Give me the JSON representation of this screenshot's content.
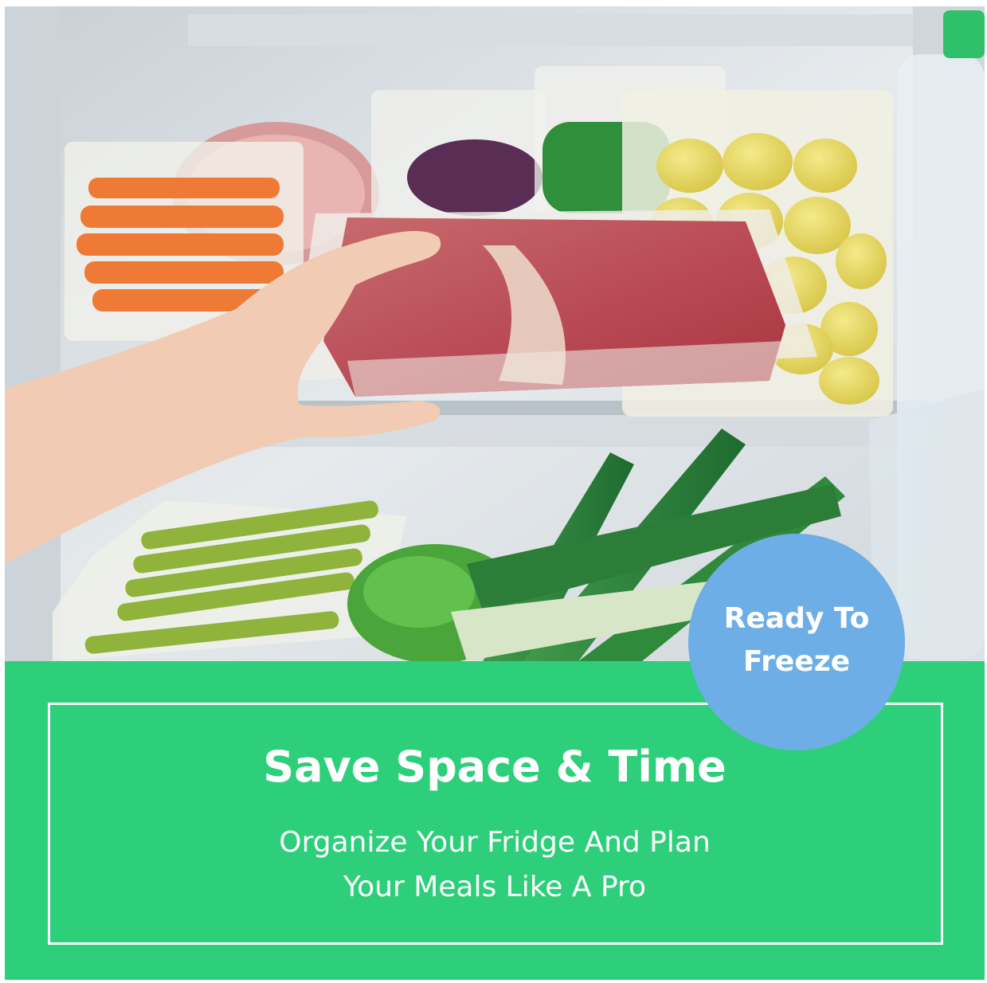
{
  "badge": {
    "line1": "Ready To",
    "line2": "Freeze",
    "color": "#6eaee6"
  },
  "panel": {
    "headline": "Save Space & Time",
    "subline1": "Organize Your Fridge And Plan",
    "subline2": "Your Meals Like A Pro",
    "color": "#2dcf7a"
  }
}
